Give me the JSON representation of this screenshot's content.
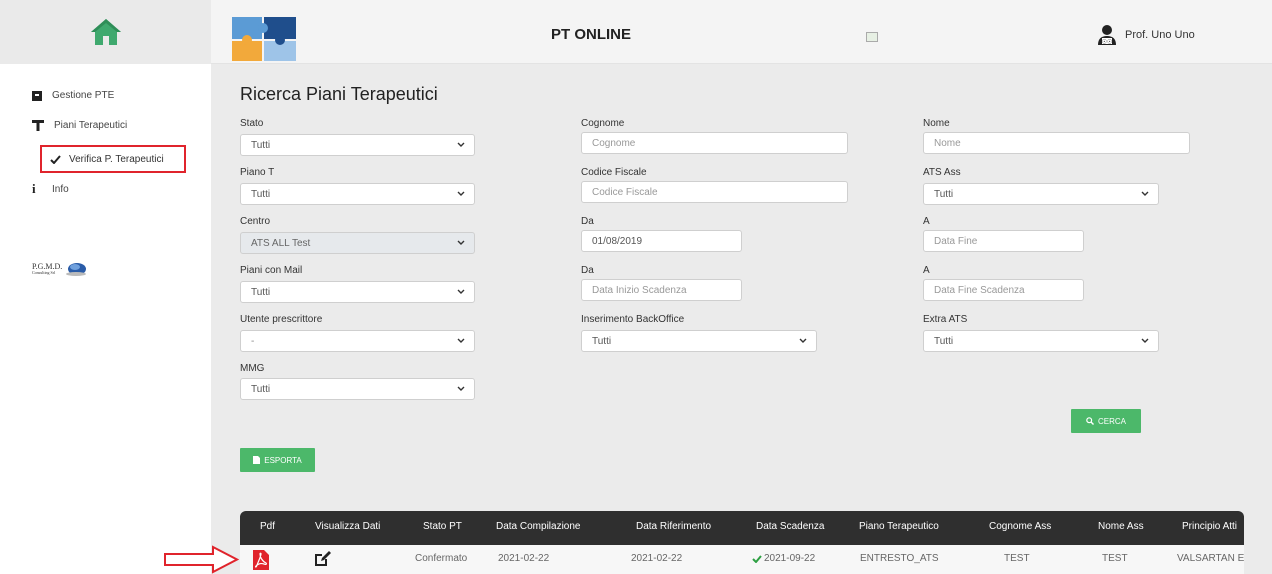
{
  "header": {
    "app_title": "PT ONLINE",
    "user_name": "Prof. Uno Uno"
  },
  "sidebar": {
    "items": [
      {
        "label": "Gestione PTE",
        "icon": "book-icon"
      },
      {
        "label": "Piani Terapeutici",
        "icon": "tau-icon"
      },
      {
        "label": "Verifica P. Terapeutici",
        "icon": "check-icon"
      },
      {
        "label": "Info",
        "icon": "info-icon"
      }
    ],
    "pgmd_logo_text": "P.G.M.D.",
    "pgmd_logo_sub": "Consulting Srl"
  },
  "form": {
    "title": "Ricerca Piani Terapeutici",
    "stato": {
      "label": "Stato",
      "value": "Tutti"
    },
    "cognome": {
      "label": "Cognome",
      "placeholder": "Cognome"
    },
    "nome": {
      "label": "Nome",
      "placeholder": "Nome"
    },
    "piano_t": {
      "label": "Piano T",
      "value": "Tutti"
    },
    "codice_fiscale": {
      "label": "Codice Fiscale",
      "placeholder": "Codice Fiscale"
    },
    "ats_ass": {
      "label": "ATS Ass",
      "value": "Tutti"
    },
    "centro": {
      "label": "Centro",
      "value": "ATS ALL Test"
    },
    "da_1": {
      "label": "Da",
      "value": "01/08/2019"
    },
    "a_1": {
      "label": "A",
      "placeholder": "Data Fine"
    },
    "piani_con_mail": {
      "label": "Piani con Mail",
      "value": "Tutti"
    },
    "da_2": {
      "label": "Da",
      "placeholder": "Data Inizio Scadenza"
    },
    "a_2": {
      "label": "A",
      "placeholder": "Data Fine Scadenza"
    },
    "utente_prescrittore": {
      "label": "Utente prescrittore",
      "value": "-"
    },
    "inserimento_backoffice": {
      "label": "Inserimento BackOffice",
      "value": "Tutti"
    },
    "extra_ats": {
      "label": "Extra ATS",
      "value": "Tutti"
    },
    "mmg": {
      "label": "MMG",
      "value": "Tutti"
    },
    "cerca_label": "CERCA",
    "esporta_label": "ESPORTA"
  },
  "table": {
    "columns": [
      "Pdf",
      "Visualizza Dati",
      "Stato PT",
      "Data Compilazione",
      "Data Riferimento",
      "Data Scadenza",
      "Piano Terapeutico",
      "Cognome Ass",
      "Nome Ass",
      "Principio Atti"
    ],
    "rows": [
      {
        "stato_pt": "Confermato",
        "data_compilazione": "2021-02-22",
        "data_riferimento": "2021-02-22",
        "data_scadenza": "2021-09-22",
        "piano_terapeutico": "ENTRESTO_ATS",
        "cognome_ass": "TEST",
        "nome_ass": "TEST",
        "principio_attivo": "VALSARTAN E"
      }
    ]
  },
  "colors": {
    "green": "#4cb86a",
    "highlight_red": "#e0242c",
    "header_dark": "#2f2f2f"
  }
}
